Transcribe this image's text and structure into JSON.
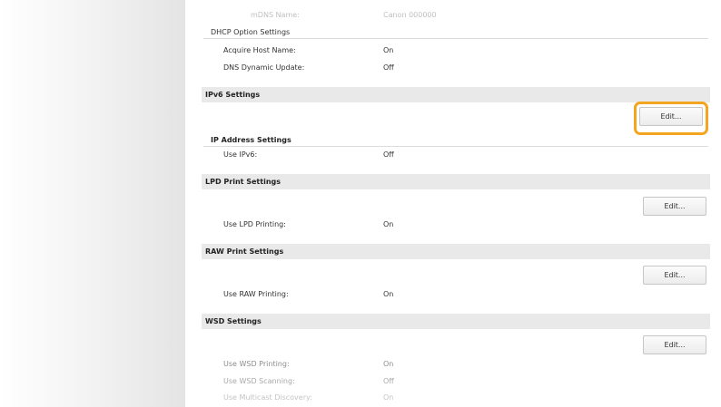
{
  "top_rows": {
    "mdns_name": {
      "label": "mDNS Name:",
      "value": "Canon 000000"
    }
  },
  "dhcp": {
    "heading": "DHCP Option Settings",
    "rows": [
      {
        "label": "Acquire Host Name:",
        "value": "On"
      },
      {
        "label": "DNS Dynamic Update:",
        "value": "Off"
      }
    ]
  },
  "ipv6": {
    "title": "IPv6 Settings",
    "edit_label": "Edit...",
    "sub_heading": "IP Address Settings",
    "rows": [
      {
        "label": "Use IPv6:",
        "value": "Off"
      }
    ]
  },
  "lpd": {
    "title": "LPD Print Settings",
    "edit_label": "Edit...",
    "rows": [
      {
        "label": "Use LPD Printing:",
        "value": "On"
      }
    ]
  },
  "raw": {
    "title": "RAW Print Settings",
    "edit_label": "Edit...",
    "rows": [
      {
        "label": "Use RAW Printing:",
        "value": "On"
      }
    ]
  },
  "wsd": {
    "title": "WSD Settings",
    "edit_label": "Edit...",
    "rows": [
      {
        "label": "Use WSD Printing:",
        "value": "On"
      },
      {
        "label": "Use WSD Scanning:",
        "value": "Off"
      },
      {
        "label": "Use Multicast Discovery:",
        "value": "On"
      }
    ]
  },
  "colors": {
    "highlight": "#f3a51f",
    "section_bar": "#e9e9e9"
  }
}
